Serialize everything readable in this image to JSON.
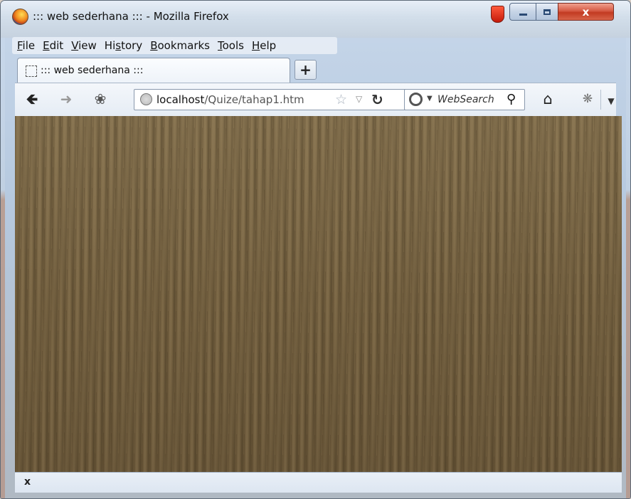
{
  "window": {
    "title": "::: web sederhana ::: - Mozilla Firefox",
    "controls": {
      "minimize": "minimize",
      "maximize": "maximize",
      "close": "x"
    }
  },
  "menu": {
    "items": [
      {
        "label_ul": "F",
        "label_rest": "ile"
      },
      {
        "label_ul": "E",
        "label_rest": "dit"
      },
      {
        "label_ul": "V",
        "label_rest": "iew"
      },
      {
        "label_pre": "Hi",
        "label_ul": "s",
        "label_rest": "tory"
      },
      {
        "label_ul": "B",
        "label_rest": "ookmarks"
      },
      {
        "label_ul": "T",
        "label_rest": "ools"
      },
      {
        "label_ul": "H",
        "label_rest": "elp"
      }
    ]
  },
  "tabs": [
    {
      "label": "::: web sederhana :::"
    }
  ],
  "newtab": {
    "label": "+"
  },
  "navbar": {
    "url_host": "localhost",
    "url_path": "/Quize/tahap1.htm",
    "search_text": "WebSearch"
  },
  "statusbar": {
    "close_label": "x"
  },
  "icons": {
    "back": "back-arrow-icon",
    "forward": "forward-arrow-icon",
    "addon": "addon-icon",
    "globe": "globe-icon",
    "star": "bookmark-star-icon",
    "reload": "reload-icon",
    "search": "search-icon",
    "home": "home-icon",
    "extension": "extension-icon",
    "menu_dropdown": "chevron-down-icon"
  },
  "colors": {
    "content_background": "#7e6a48",
    "close_button": "#c23a22"
  }
}
